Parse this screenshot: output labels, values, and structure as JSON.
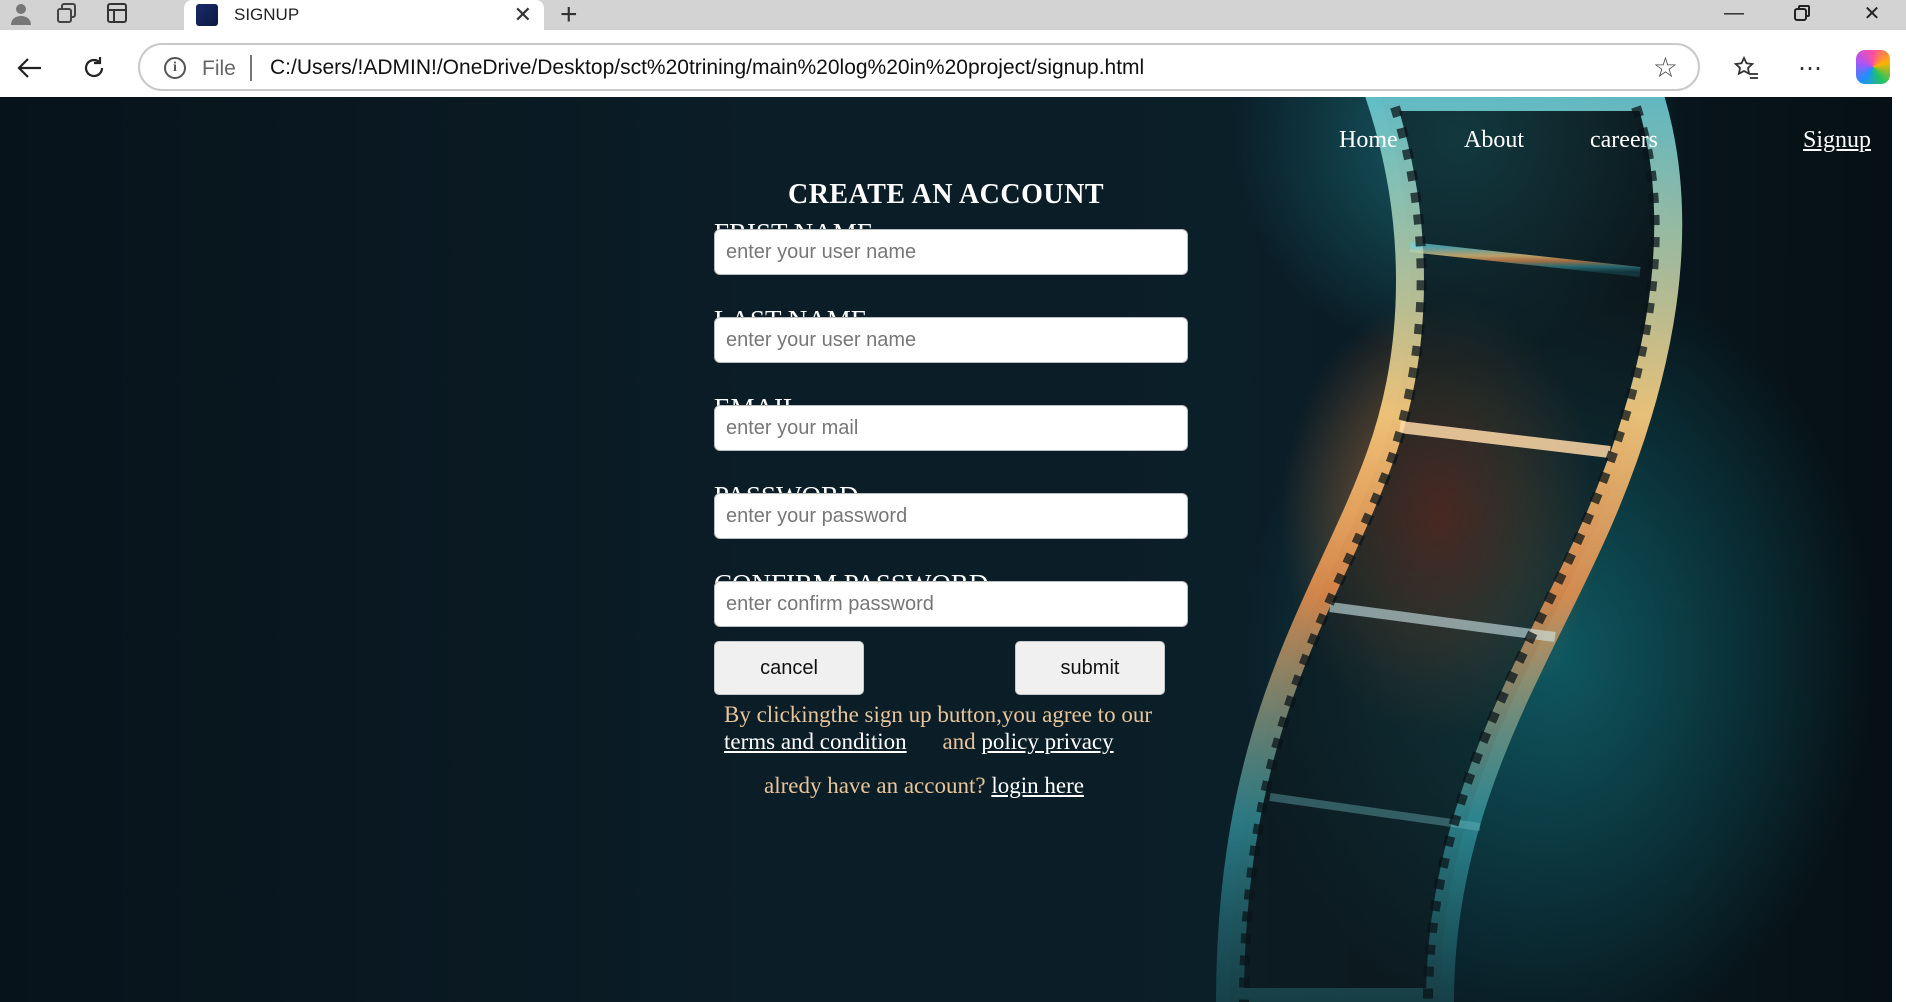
{
  "browser": {
    "tab_title": "SIGNUP",
    "address_prefix": "File",
    "url": "C:/Users/!ADMIN!/OneDrive/Desktop/sct%20trining/main%20log%20in%20project/signup.html"
  },
  "nav": {
    "home": "Home",
    "about": "About",
    "careers": "careers",
    "signup": "Signup"
  },
  "form": {
    "title": "CREATE AN ACCOUNT",
    "fields": [
      {
        "label": "FRIST NAME",
        "placeholder": "enter your user name",
        "value": ""
      },
      {
        "label": "LAST NAME",
        "placeholder": "enter your user name",
        "value": ""
      },
      {
        "label": "EMAIL",
        "placeholder": "enter your mail",
        "value": ""
      },
      {
        "label": "PASSWORD",
        "placeholder": "enter your password",
        "value": ""
      },
      {
        "label": "CONFIRM PASSWORD",
        "placeholder": "enter confirm password",
        "value": ""
      }
    ],
    "cancel_label": "cancel",
    "submit_label": "submit"
  },
  "terms": {
    "text": "By clickingthe sign up button,you agree to our",
    "terms_link": "terms and condition",
    "and_text": "and",
    "privacy_link": "policy privacy"
  },
  "login": {
    "text": "alredy have an account?",
    "link": "login here"
  },
  "colors": {
    "page_bg": "#0b1d27",
    "accent_text": "#e8c59a",
    "input_bg": "#ffffff",
    "button_bg": "#f0f0f0"
  }
}
